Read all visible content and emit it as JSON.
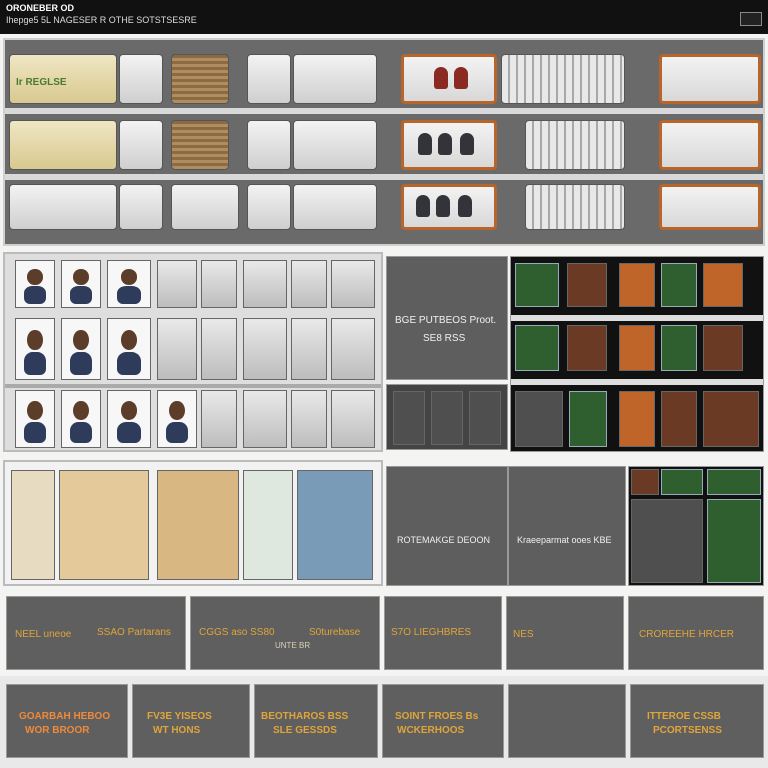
{
  "window": {
    "title": "ORONEBER OD",
    "subtitle": "Ihepge5 5L NAGESER R OTHE SOTSTSESRE"
  },
  "top_shelf": {
    "box_label": "Ir REGLSE"
  },
  "middle_panel": {
    "caption_line1": "BGE PUTBEOS Proot.",
    "caption_line2": "SE8 RSS"
  },
  "lower_panel": {
    "left_caption": "ROTEMAKGE DEOON",
    "right_caption": "Kraeeparmat ooes KBE"
  },
  "price_row": {
    "items": [
      {
        "text": "NEEL uneoe"
      },
      {
        "text": "SSAO Partarans"
      },
      {
        "text": "CGGS aso SS80",
        "sub": "UNTE BR"
      },
      {
        "text": "S0turebase"
      },
      {
        "text": "S7O LIEGHBRES"
      },
      {
        "text": "NES"
      },
      {
        "text": "CROREEHE HRCER"
      }
    ]
  },
  "bottom_row": {
    "items": [
      {
        "line1": "GOARBAH HEBOO",
        "line2": "WOR BROOR"
      },
      {
        "line1": "FV3E YISEOS",
        "line2": "WT HONS"
      },
      {
        "line1": "BEOTHAROS BSS",
        "line2": "SLE GESSDS"
      },
      {
        "line1": "SOINT FROES Bs",
        "line2": "WCKERHOOS"
      },
      {
        "line1": "",
        "line2": ""
      },
      {
        "line1": "ITTEROE CSSB",
        "line2": "PCORTSENSS"
      }
    ]
  }
}
